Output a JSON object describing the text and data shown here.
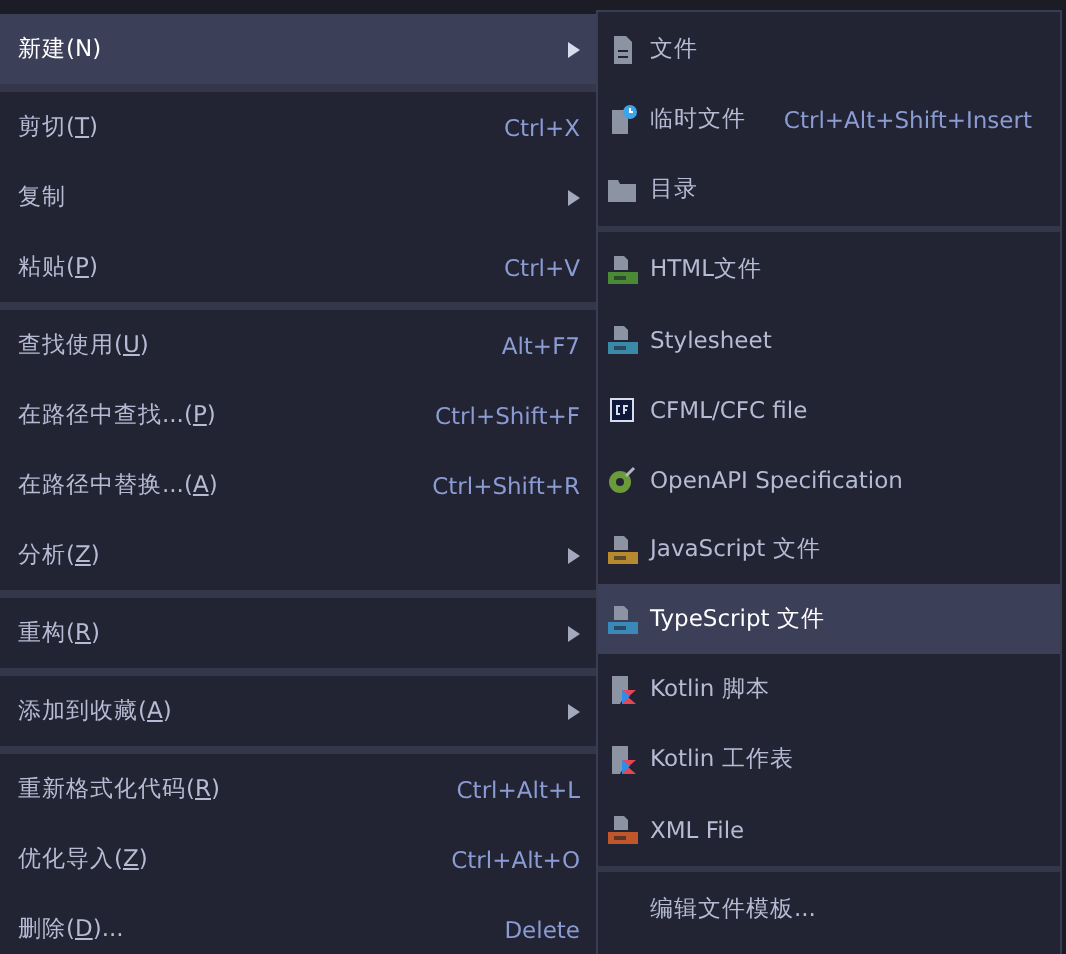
{
  "menu": {
    "items": [
      {
        "kind": "item",
        "label": "新建(N)",
        "submenu": true,
        "selected": true
      },
      {
        "kind": "separator"
      },
      {
        "kind": "item",
        "label": "剪切(",
        "mnemonic": "T",
        "after": ")",
        "shortcut": "Ctrl+X",
        "submenu": false,
        "selected": false
      },
      {
        "kind": "item",
        "label": "复制",
        "submenu": true,
        "selected": false
      },
      {
        "kind": "item",
        "label": "粘贴(",
        "mnemonic": "P",
        "after": ")",
        "shortcut": "Ctrl+V",
        "submenu": false,
        "selected": false
      },
      {
        "kind": "separator"
      },
      {
        "kind": "item",
        "label": "查找使用(",
        "mnemonic": "U",
        "after": ")",
        "shortcut": "Alt+F7",
        "submenu": false,
        "selected": false
      },
      {
        "kind": "item",
        "label": "在路径中查找...(",
        "mnemonic": "P",
        "after": ")",
        "shortcut": "Ctrl+Shift+F",
        "submenu": false,
        "selected": false
      },
      {
        "kind": "item",
        "label": "在路径中替换...(",
        "mnemonic": "A",
        "after": ")",
        "shortcut": "Ctrl+Shift+R",
        "submenu": false,
        "selected": false
      },
      {
        "kind": "item",
        "label": "分析(",
        "mnemonic": "Z",
        "after": ")",
        "submenu": true,
        "selected": false
      },
      {
        "kind": "separator"
      },
      {
        "kind": "item",
        "label": "重构(",
        "mnemonic": "R",
        "after": ")",
        "submenu": true,
        "selected": false
      },
      {
        "kind": "separator"
      },
      {
        "kind": "item",
        "label": "添加到收藏(",
        "mnemonic": "A",
        "after": ")",
        "submenu": true,
        "selected": false
      },
      {
        "kind": "separator"
      },
      {
        "kind": "item",
        "label": "重新格式化代码(",
        "mnemonic": "R",
        "after": ")",
        "shortcut": "Ctrl+Alt+L",
        "submenu": false,
        "selected": false
      },
      {
        "kind": "item",
        "label": "优化导入(",
        "mnemonic": "Z",
        "after": ")",
        "shortcut": "Ctrl+Alt+O",
        "submenu": false,
        "selected": false
      },
      {
        "kind": "item",
        "label": "删除(",
        "mnemonic": "D",
        "after": ")...",
        "shortcut": "Delete",
        "submenu": false,
        "selected": false
      }
    ]
  },
  "submenu": {
    "items": [
      {
        "kind": "file",
        "label": "文件",
        "selected": false
      },
      {
        "kind": "scratch",
        "label": "临时文件",
        "shortcut": "Ctrl+Alt+Shift+Insert",
        "selected": false
      },
      {
        "kind": "folder",
        "label": "目录",
        "selected": false
      },
      {
        "kind": "separator"
      },
      {
        "kind": "html",
        "label": "HTML文件",
        "selected": false
      },
      {
        "kind": "css",
        "label": "Stylesheet",
        "selected": false
      },
      {
        "kind": "cf",
        "label": "CFML/CFC file",
        "selected": false
      },
      {
        "kind": "openapi",
        "label": "OpenAPI Specification",
        "selected": false
      },
      {
        "kind": "js",
        "label": "JavaScript 文件",
        "selected": false
      },
      {
        "kind": "ts",
        "label": "TypeScript 文件",
        "selected": true
      },
      {
        "kind": "kotlin",
        "label": "Kotlin 脚本",
        "selected": false
      },
      {
        "kind": "kotlin",
        "label": "Kotlin 工作表",
        "selected": false
      },
      {
        "kind": "xml",
        "label": "XML File",
        "selected": false
      },
      {
        "kind": "separator"
      },
      {
        "kind": "plain",
        "label": "编辑文件模板...",
        "selected": false
      }
    ]
  }
}
